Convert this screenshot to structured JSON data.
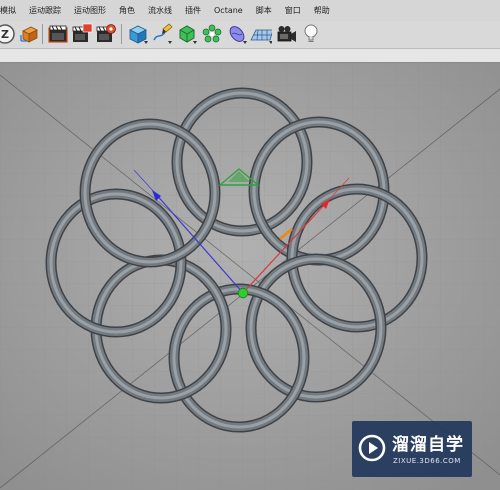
{
  "menubar": {
    "items": [
      {
        "label": "模拟"
      },
      {
        "label": "运动跟踪"
      },
      {
        "label": "运动图形"
      },
      {
        "label": "角色"
      },
      {
        "label": "流水线"
      },
      {
        "label": "插件"
      },
      {
        "label": "Octane"
      },
      {
        "label": "脚本"
      },
      {
        "label": "窗口"
      },
      {
        "label": "帮助"
      }
    ]
  },
  "toolbar": {
    "buttons": [
      {
        "icon": "make-editable-icon"
      },
      {
        "icon": "cube-orange-icon"
      },
      {
        "icon": "render-view-icon"
      },
      {
        "icon": "render-picture-viewer-icon"
      },
      {
        "icon": "render-settings-icon"
      },
      {
        "icon": "cube-primitive-icon"
      },
      {
        "icon": "pen-spline-icon"
      },
      {
        "icon": "subdivision-surface-icon"
      },
      {
        "icon": "cloner-icon"
      },
      {
        "icon": "deformer-icon"
      },
      {
        "icon": "floor-scene-icon"
      },
      {
        "icon": "camera-icon"
      },
      {
        "icon": "light-icon"
      }
    ]
  },
  "viewport": {
    "object": "rings",
    "ring_color": "#747b80",
    "axis_colors": {
      "x": "#d93a3a",
      "y": "#2fa23a",
      "z": "#3a3ad0"
    }
  },
  "watermark": {
    "title": "溜溜自学",
    "url": "ZIXUE.3D66.COM"
  }
}
